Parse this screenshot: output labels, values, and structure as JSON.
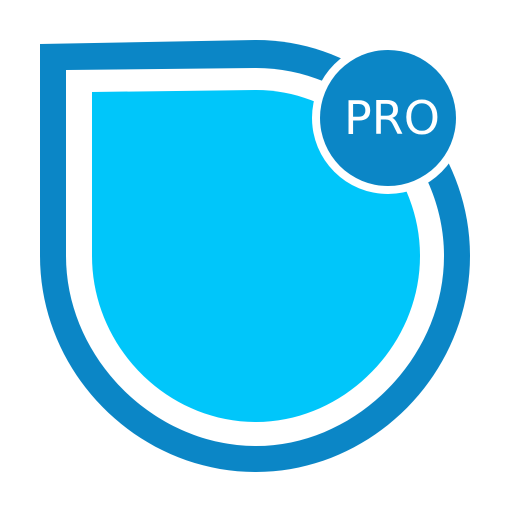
{
  "app_icon": {
    "badge": {
      "label": "PRO"
    },
    "colors": {
      "outer_ring": "#0B86C6",
      "inner_fill": "#00C6FA",
      "badge_fill": "#0B86C6",
      "badge_border": "#FFFFFF",
      "badge_text": "#FFFFFF",
      "background": "#FFFFFF"
    },
    "icon_names": [
      "shield-icon",
      "water-drop-icon"
    ]
  }
}
